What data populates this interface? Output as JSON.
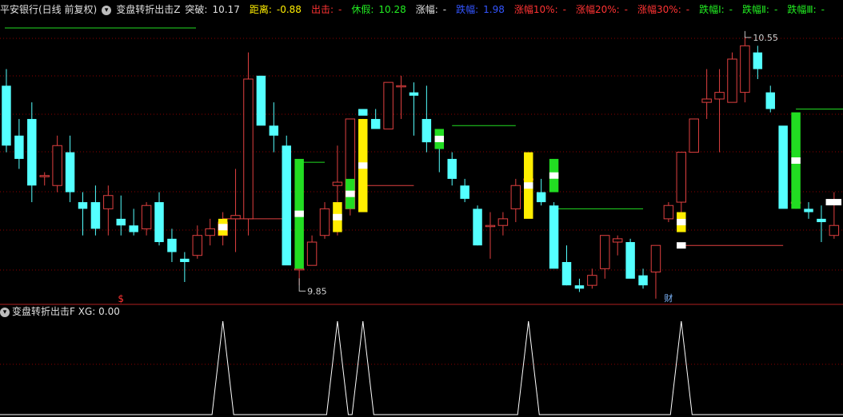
{
  "header": {
    "stock": "平安银行(日线 前复权)",
    "indicator_icon": "circle-down-icon",
    "indicator_name": "变盘转折出击Z",
    "breakout_label": "突破:",
    "breakout_value": "10.17",
    "distance_label": "距离:",
    "distance_value": "-0.88",
    "exit_label": "出击:",
    "exit_value": "-",
    "fake_label": "休假:",
    "fake_value": "10.28",
    "rise_label": "涨幅:",
    "rise_value": "-",
    "fall_label": "跌幅:",
    "fall_value": "1.98",
    "rise10_label": "涨幅10%:",
    "rise10_value": "-",
    "rise20_label": "涨幅20%:",
    "rise20_value": "-",
    "rise30_label": "涨幅30%:",
    "rise30_value": "-",
    "fall1_label": "跌幅Ⅰ:",
    "fall1_value": "-",
    "fall2_label": "跌幅Ⅱ:",
    "fall2_value": "-",
    "fall3_label": "跌幅Ⅲ:",
    "fall3_value": "-"
  },
  "sub_header": {
    "icon": "circle-down-icon",
    "name": "变盘转折出击F",
    "xg_label": "XG:",
    "xg_value": "0.00"
  },
  "colors": {
    "up": "#e04040",
    "down": "#54ffff",
    "yellow": "#ffee00",
    "green": "#22dd22",
    "white": "#ffffff",
    "grid": "#8b0000",
    "divider": "#b02020",
    "signal": "#ffffff"
  },
  "chart_data": [
    {
      "type": "candlestick",
      "x": [
        1,
        2,
        3,
        4,
        5,
        6,
        7,
        8,
        9,
        10,
        11,
        12,
        13,
        14,
        15,
        16,
        17,
        18,
        19,
        20,
        21,
        22,
        23,
        24,
        25,
        26,
        27,
        28,
        29,
        30,
        31,
        32,
        33,
        34,
        35,
        36,
        37,
        38,
        39,
        40,
        41,
        42,
        43,
        44,
        45,
        46,
        47,
        48,
        49,
        50,
        51,
        52,
        53,
        54,
        55,
        56,
        57,
        58,
        59,
        60,
        61,
        62,
        63,
        64,
        65,
        66
      ],
      "ohlc": [
        [
          10.4,
          10.45,
          10.2,
          10.22
        ],
        [
          10.25,
          10.3,
          10.15,
          10.18
        ],
        [
          10.3,
          10.35,
          10.05,
          10.1
        ],
        [
          10.13,
          10.14,
          10.1,
          10.13
        ],
        [
          10.1,
          10.25,
          10.08,
          10.22
        ],
        [
          10.2,
          10.25,
          10.05,
          10.08
        ],
        [
          10.05,
          10.08,
          9.95,
          10.03
        ],
        [
          10.05,
          10.1,
          9.95,
          9.97
        ],
        [
          10.03,
          10.1,
          9.95,
          10.07
        ],
        [
          10.0,
          10.07,
          9.95,
          9.98
        ],
        [
          9.98,
          10.03,
          9.95,
          9.96
        ],
        [
          9.97,
          10.05,
          9.95,
          10.04
        ],
        [
          10.05,
          10.08,
          9.92,
          9.93
        ],
        [
          9.94,
          9.97,
          9.87,
          9.9
        ],
        [
          9.88,
          9.9,
          9.81,
          9.87
        ],
        [
          9.89,
          9.98,
          9.88,
          9.95
        ],
        [
          9.95,
          10.0,
          9.92,
          9.97
        ],
        [
          9.95,
          10.02,
          9.92,
          9.99
        ],
        [
          10.0,
          10.15,
          9.9,
          10.01
        ],
        [
          10.0,
          10.5,
          9.95,
          10.42
        ],
        [
          10.43,
          10.43,
          10.3,
          10.28
        ],
        [
          10.28,
          10.35,
          10.2,
          10.25
        ],
        [
          10.22,
          10.25,
          9.87,
          9.86
        ],
        [
          9.85,
          9.91,
          9.8,
          9.85
        ],
        [
          9.86,
          9.95,
          9.87,
          9.93
        ],
        [
          9.95,
          10.05,
          9.94,
          10.03
        ],
        [
          10.1,
          10.22,
          9.95,
          10.11
        ],
        [
          10.03,
          10.3,
          10.01,
          10.3
        ],
        [
          10.33,
          10.3,
          10.28,
          10.31
        ],
        [
          10.3,
          10.33,
          10.28,
          10.27
        ],
        [
          10.27,
          10.4,
          10.27,
          10.41
        ],
        [
          10.4,
          10.43,
          10.3,
          10.4
        ],
        [
          10.38,
          10.41,
          10.25,
          10.37
        ],
        [
          10.3,
          10.4,
          10.2,
          10.23
        ],
        [
          10.25,
          10.21,
          10.14,
          10.21
        ],
        [
          10.18,
          10.2,
          10.1,
          10.12
        ],
        [
          10.1,
          10.12,
          10.05,
          10.06
        ],
        [
          10.03,
          10.04,
          9.92,
          9.92
        ],
        [
          9.98,
          10.02,
          9.88,
          9.98
        ],
        [
          9.98,
          10.02,
          9.95,
          10.0
        ],
        [
          10.03,
          10.12,
          9.99,
          10.1
        ],
        [
          10.12,
          10.08,
          10.01,
          10.12
        ],
        [
          10.08,
          10.12,
          10.04,
          10.05
        ],
        [
          10.04,
          10.05,
          9.9,
          9.85
        ],
        [
          9.87,
          9.92,
          9.8,
          9.8
        ],
        [
          9.8,
          9.82,
          9.78,
          9.79
        ],
        [
          9.8,
          9.85,
          9.79,
          9.83
        ],
        [
          9.85,
          9.95,
          9.82,
          9.95
        ],
        [
          9.93,
          9.95,
          9.89,
          9.94
        ],
        [
          9.93,
          9.94,
          9.84,
          9.82
        ],
        [
          9.83,
          9.85,
          9.79,
          9.8
        ],
        [
          9.84,
          9.9,
          9.76,
          9.92
        ],
        [
          10.0,
          10.05,
          9.99,
          10.04
        ],
        [
          10.05,
          10.15,
          10.0,
          10.2
        ],
        [
          10.2,
          10.3,
          10.2,
          10.3
        ],
        [
          10.35,
          10.45,
          10.3,
          10.36
        ],
        [
          10.36,
          10.45,
          10.2,
          10.38
        ],
        [
          10.35,
          10.5,
          10.35,
          10.48
        ],
        [
          10.38,
          10.55,
          10.35,
          10.52
        ],
        [
          10.5,
          10.52,
          10.42,
          10.45
        ],
        [
          10.38,
          10.4,
          10.32,
          10.33
        ],
        [
          10.28,
          10.25,
          10.05,
          10.03
        ],
        [
          10.05,
          10.1,
          10.03,
          10.05
        ],
        [
          10.03,
          10.05,
          10.0,
          10.02
        ],
        [
          10.0,
          10.04,
          9.93,
          9.99
        ],
        [
          9.95,
          10.08,
          9.94,
          9.98
        ]
      ],
      "y_high_label": "10.55",
      "y_low_label": "9.85",
      "xlabel": "",
      "ylabel": "",
      "markers": [
        {
          "index": 9,
          "text": "$"
        },
        {
          "index": 52,
          "text": "财"
        }
      ],
      "signal_levels": [
        {
          "from": 23,
          "to": 25,
          "value": 10.17,
          "color": "green"
        },
        {
          "from": 17,
          "to": 22,
          "value": 10.0,
          "color": "red"
        },
        {
          "from": 28,
          "to": 32,
          "value": 10.1,
          "color": "red"
        },
        {
          "from": 35,
          "to": 40,
          "value": 10.28,
          "color": "green"
        },
        {
          "from": 43,
          "to": 50,
          "value": 10.03,
          "color": "green"
        },
        {
          "from": 53,
          "to": 61,
          "value": 9.92,
          "color": "red"
        },
        {
          "from": 62,
          "to": 68,
          "value": 10.33,
          "color": "green"
        }
      ],
      "highlight_bars": [
        {
          "index": 17,
          "color": "yellow",
          "open": 9.95,
          "close": 10.0
        },
        {
          "index": 23,
          "color": "green",
          "open": 10.18,
          "close": 9.85
        },
        {
          "index": 26,
          "color": "yellow",
          "open": 9.96,
          "close": 10.05
        },
        {
          "index": 27,
          "color": "green",
          "open": 10.03,
          "close": 10.12
        },
        {
          "index": 28,
          "color": "yellow",
          "open": 10.3,
          "close": 10.02
        },
        {
          "index": 34,
          "color": "green",
          "open": 10.27,
          "close": 10.21
        },
        {
          "index": 41,
          "color": "yellow",
          "open": 10.2,
          "close": 10.0
        },
        {
          "index": 43,
          "color": "green",
          "open": 10.18,
          "close": 10.08
        },
        {
          "index": 53,
          "color": "yellow",
          "open": 10.02,
          "close": 9.96
        },
        {
          "index": 62,
          "color": "green",
          "open": 10.32,
          "close": 10.03
        }
      ]
    },
    {
      "type": "line",
      "series_label": "XG",
      "spikes": [
        17,
        26,
        28,
        41,
        53
      ],
      "ylim": [
        0,
        1
      ]
    }
  ]
}
